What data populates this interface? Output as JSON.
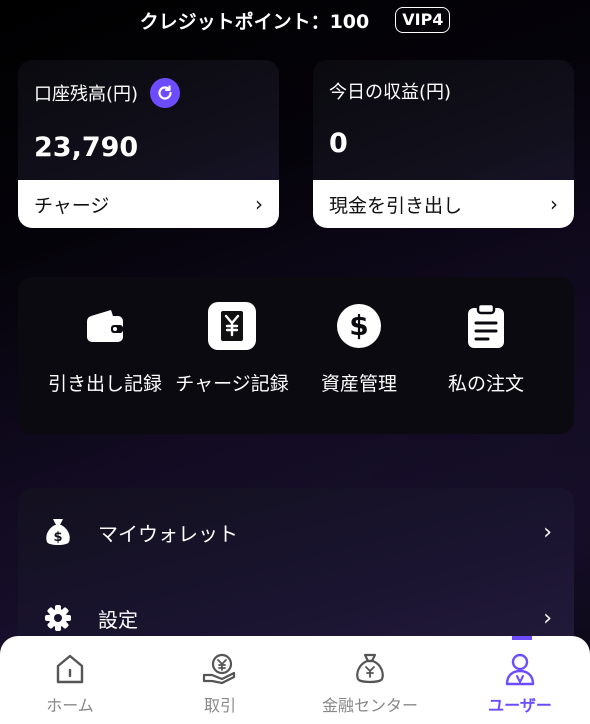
{
  "header": {
    "credit_text": "クレジットポイント：100",
    "vip_badge": "VIP4"
  },
  "balance_card": {
    "label": "口座残高(円)",
    "value": "23,790",
    "action": "チャージ"
  },
  "earnings_card": {
    "label": "今日の収益(円)",
    "value": "0",
    "action": "現金を引き出し"
  },
  "quick_actions": [
    {
      "label": "引き出し記録",
      "icon": "wallet-icon"
    },
    {
      "label": "チャージ記録",
      "icon": "yen-receipt-icon"
    },
    {
      "label": "資産管理",
      "icon": "dollar-coin-icon"
    },
    {
      "label": "私の注文",
      "icon": "clipboard-icon"
    }
  ],
  "menu": [
    {
      "label": "マイウォレット",
      "icon": "money-bag-icon"
    },
    {
      "label": "設定",
      "icon": "gear-icon"
    }
  ],
  "tabbar": {
    "tabs": [
      {
        "label": "ホーム",
        "icon": "home-icon"
      },
      {
        "label": "取引",
        "icon": "trade-icon"
      },
      {
        "label": "金融センター",
        "icon": "finance-bag-icon"
      },
      {
        "label": "ユーザー",
        "icon": "user-icon"
      }
    ],
    "active_tab": "ユーザー"
  },
  "colors": {
    "accent": "#6d4cff",
    "background": "#0a0812",
    "card_action_bg": "#ffffff"
  }
}
